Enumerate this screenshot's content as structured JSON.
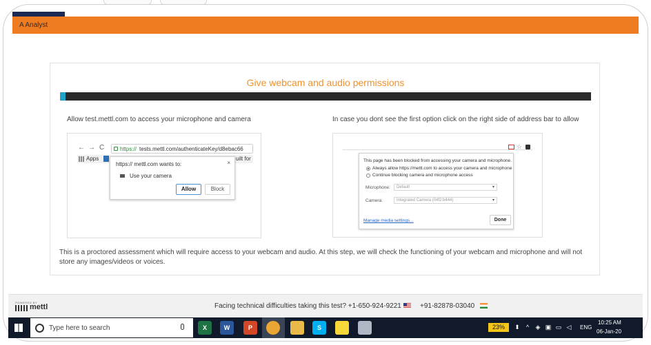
{
  "window": {
    "app_title": "A Analyst",
    "accent_color": "#f07c21"
  },
  "card": {
    "heading": "Give webcam and audio permissions",
    "heading_color": "#f0922f",
    "step_progress": 0.01,
    "left_instruction": "Allow test.mettl.com to access your microphone and camera",
    "right_instruction": "In case you dont see the first option click on the right side of address bar to allow",
    "disclaimer": "This is a proctored assessment which will require access to your webcam and audio. At this step, we will check the functioning of your webcam and microphone and will not store any images/videos or voices."
  },
  "left_example": {
    "nav_back": "←",
    "nav_forward": "→",
    "nav_reload": "C",
    "url_secure": "https://",
    "url_rest": "tests.mettl.com/authenticateKey/d8ebac66",
    "bookmark_apps": "Apps",
    "bookmark_trailing": "uilt for",
    "prompt_title": "https:// mettl.com wants to:",
    "prompt_close": "×",
    "prompt_permission": "Use your camera",
    "allow_label": "Allow",
    "block_label": "Block"
  },
  "right_example": {
    "star_icon": "☆",
    "popup_title": "This page has been blocked from accessing your camera and microphone.",
    "option_allow": "Always allow https://mettl.com to access your camera and microphone",
    "option_block": "Continue blocking camera and microphone access",
    "microphone_label": "Microphone:",
    "microphone_value": "Default",
    "camera_label": "Camera:",
    "camera_value": "Integrated Camera (04f2:b444)",
    "caret": "▾",
    "manage_link": "Manage media settings...",
    "done_label": "Done"
  },
  "footer": {
    "powered_by": "POWERED BY",
    "brand": "mettl",
    "help_text": "Facing technical difficulties taking this test? +1-650-924-9221",
    "help_phone_india": "+91-82878-03040"
  },
  "taskbar": {
    "search_placeholder": "Type here to search",
    "apps": [
      {
        "name": "excel",
        "glyph": "X",
        "color": "#1f7244"
      },
      {
        "name": "word",
        "glyph": "W",
        "color": "#2b579a"
      },
      {
        "name": "powerpoint",
        "glyph": "P",
        "color": "#d24726"
      },
      {
        "name": "chrome",
        "glyph": "",
        "color": "#e8a735"
      },
      {
        "name": "file-explorer",
        "glyph": "",
        "color": "#e9b949"
      },
      {
        "name": "skype",
        "glyph": "S",
        "color": "#00aff0"
      },
      {
        "name": "sticky-notes",
        "glyph": "",
        "color": "#f7d83a"
      },
      {
        "name": "paint",
        "glyph": "",
        "color": "#b0b8c6"
      }
    ],
    "battery": "23%",
    "language": "ENG",
    "time": "10:25 AM",
    "date": "06-Jan-20"
  }
}
